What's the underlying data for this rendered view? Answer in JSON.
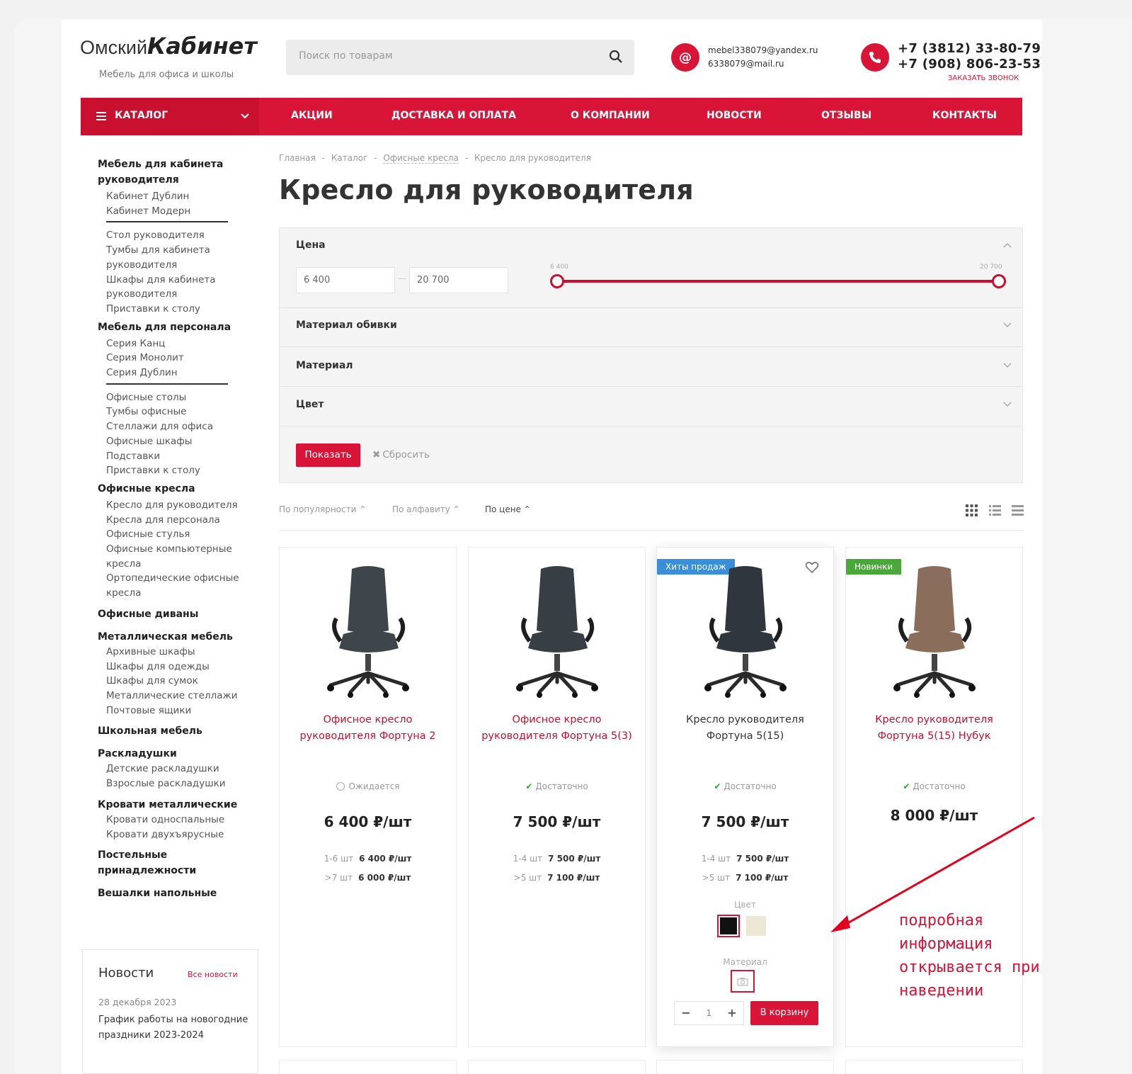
{
  "header": {
    "logo_left": "Омский",
    "logo_right": "Кабинет",
    "logo_tagline": "Мебель для офиса и школы",
    "search_placeholder": "Поиск по товарам",
    "emails": [
      "mebel338079@yandex.ru",
      "6338079@mail.ru"
    ],
    "phones": [
      "+7 (3812) 33-80-79",
      "+7 (908) 806-23-53"
    ],
    "callback": "ЗАКАЗАТЬ ЗВОНОК"
  },
  "nav": {
    "catalog": "КАТАЛОГ",
    "items": [
      "АКЦИИ",
      "ДОСТАВКА И ОПЛАТА",
      "О КОМПАНИИ",
      "НОВОСТИ",
      "ОТЗЫВЫ",
      "КОНТАКТЫ"
    ]
  },
  "sidebar": {
    "sections": [
      {
        "title": "Мебель для кабинета руководителя",
        "links": [
          "Кабинет Дублин",
          "Кабинет Модерн",
          "Стол руководителя",
          "Тумбы для кабинета руководителя",
          "Шкафы для кабинета руководителя",
          "Приставки к столу"
        ]
      },
      {
        "title": "Мебель для персонала",
        "links": [
          "Серия Канц",
          "Серия Монолит",
          "Серия Дублин",
          "Офисные столы",
          "Тумбы офисные",
          "Стеллажи для офиса",
          "Офисные шкафы",
          "Подставки",
          "Приставки к столу"
        ]
      },
      {
        "title": "Офисные кресла",
        "links": [
          "Кресло для руководителя",
          "Кресла для персонала",
          "Офисные стулья",
          "Офисные компьютерные кресла",
          "Ортопедические офисные кресла"
        ]
      },
      {
        "title": "Офисные диваны",
        "links": []
      },
      {
        "title": "Металлическая мебель",
        "links": [
          "Архивные шкафы",
          "Шкафы для одежды",
          "Шкафы для сумок",
          "Металлические стеллажи",
          "Почтовые ящики"
        ]
      },
      {
        "title": "Школьная мебель",
        "links": []
      },
      {
        "title": "Раскладушки",
        "links": [
          "Детские раскладушки",
          "Взрослые раскладушки"
        ]
      },
      {
        "title": "Кровати металлические",
        "links": [
          "Кровати односпальные",
          "Кровати двухъярусные"
        ]
      },
      {
        "title": "Постельные принадлежности",
        "links": []
      },
      {
        "title": "Вешалки напольные",
        "links": []
      }
    ],
    "news": {
      "title": "Новости",
      "all": "Все новости",
      "date": "28 декабря 2023",
      "text": "График работы на новогодние праздники 2023-2024"
    }
  },
  "breadcrumbs": [
    "Главная",
    "Каталог",
    "Офисные кресла",
    "Кресло для руководителя"
  ],
  "page_title": "Кресло для руководителя",
  "filter": {
    "price_label": "Цена",
    "price_from": "6 400",
    "price_to": "20 700",
    "slider_min_label": "6 400",
    "slider_max_label": "20 700",
    "groups": [
      "Материал обивки",
      "Материал",
      "Цвет"
    ],
    "show": "Показать",
    "reset": "Сбросить"
  },
  "sort": {
    "options": [
      "По популярности",
      "По алфавиту",
      "По цене"
    ],
    "active": "По цене"
  },
  "products": [
    {
      "title": "Офисное кресло руководителя Фортуна 2",
      "stock": "Ожидается",
      "price": "6 400 ₽/шт",
      "tiers": [
        [
          "1-6 шт",
          "6 400 ₽/шт"
        ],
        [
          ">7 шт",
          "6 000 ₽/шт"
        ]
      ],
      "badge": "",
      "upholstery": "#3e464b"
    },
    {
      "title": "Офисное кресло руководителя Фортуна 5(3)",
      "stock": "Достаточно",
      "price": "7 500 ₽/шт",
      "tiers": [
        [
          "1-4 шт",
          "7 500 ₽/шт"
        ],
        [
          ">5 шт",
          "7 100 ₽/шт"
        ]
      ],
      "badge": "",
      "upholstery": "#373f45"
    },
    {
      "title": "Кресло руководителя Фортуна 5(15)",
      "stock": "Достаточно",
      "price": "7 500 ₽/шт",
      "tiers": [
        [
          "1-4 шт",
          "7 500 ₽/шт"
        ],
        [
          ">5 шт",
          "7 100 ₽/шт"
        ]
      ],
      "badge": "Хиты продаж",
      "badge_color": "#3a8fd8",
      "upholstery": "#2f363d"
    },
    {
      "title": "Кресло руководителя Фортуна 5(15) Нубук",
      "stock": "Достаточно",
      "price": "8 000 ₽/шт",
      "tiers": [],
      "badge": "Новинки",
      "badge_color": "#4aa83a",
      "upholstery": "#8a6d5a"
    }
  ],
  "hover_card": {
    "color_label": "Цвет",
    "material_label": "Материал",
    "qty": "1",
    "cart": "В корзину",
    "colors": [
      "#111111",
      "#ede8d6"
    ]
  },
  "annotation": {
    "lines": [
      "подробная",
      "информация",
      "открывается при",
      "наведении"
    ]
  },
  "colors": {
    "brand": "#d81437"
  }
}
